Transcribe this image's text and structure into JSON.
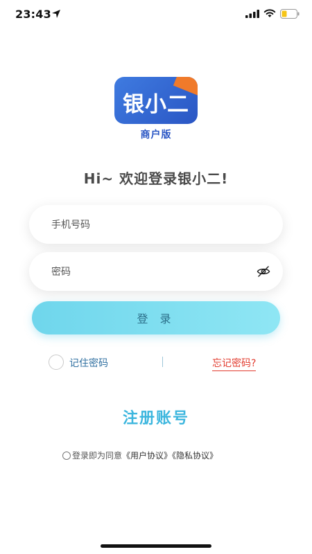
{
  "status_bar": {
    "time": "23:43",
    "icons": [
      "location-arrow-icon",
      "signal-icon",
      "wifi-icon",
      "battery-icon"
    ],
    "battery_color": "#f5c518"
  },
  "logo": {
    "title": "银小二",
    "subtitle": "商户版",
    "colors": {
      "primary": "#2a56c4",
      "accent": "#f07a2a"
    }
  },
  "welcome": "Hi~ 欢迎登录银小二!",
  "form": {
    "phone_placeholder": "手机号码",
    "password_placeholder": "密码",
    "password_toggle_icon": "eye-slash-icon",
    "login_label": "登 录"
  },
  "options": {
    "remember_label": "记住密码",
    "separator": "|",
    "forgot_label": "忘记密码?"
  },
  "register_label": "注册账号",
  "agreement": {
    "prefix": "登录即为同意",
    "user_agreement": "《用户协议》",
    "privacy_policy": "《隐私协议》"
  },
  "colors": {
    "login_button": "#7ddcef",
    "register": "#3cb6de",
    "forgot": "#e23b2e",
    "remember": "#2f6fa0"
  }
}
